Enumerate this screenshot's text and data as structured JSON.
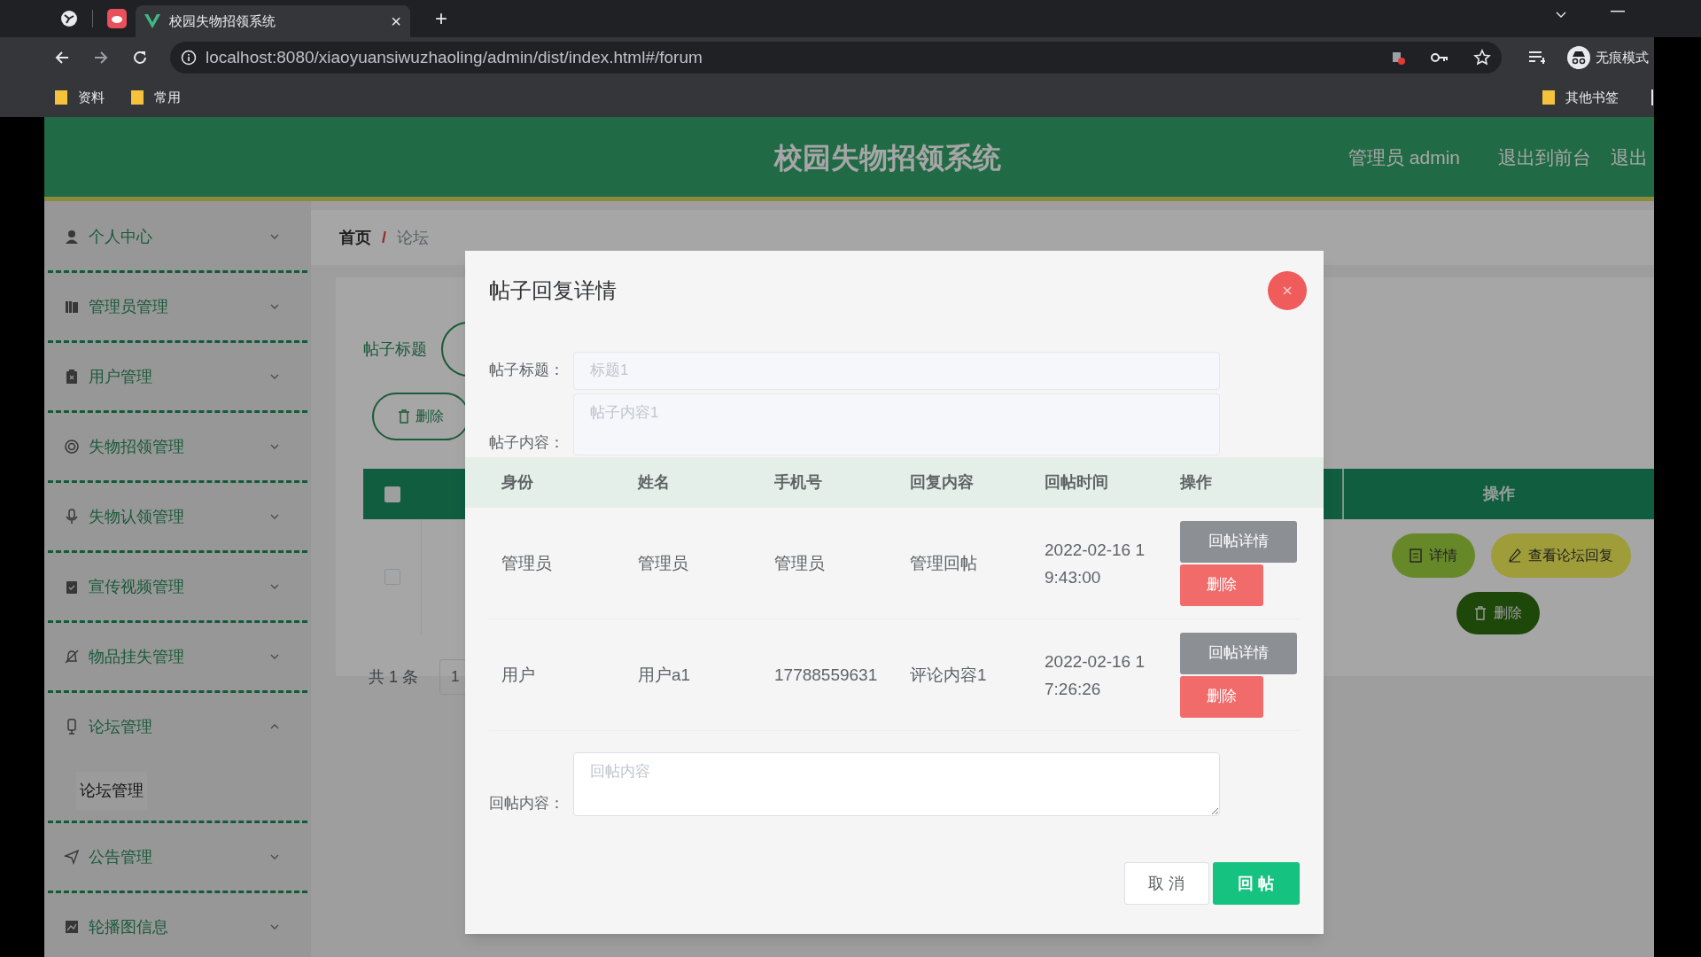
{
  "browser": {
    "tab_title": "校园失物招领系统",
    "close": "×",
    "new_tab": "+",
    "url": "localhost:8080/xiaoyuansiwuzhaoling/admin/dist/index.html#/forum",
    "profile": "无痕模式",
    "bookmarks": [
      "资料",
      "常用"
    ],
    "other_bookmarks": "其他书签"
  },
  "header": {
    "title": "校园失物招领系统",
    "user": "管理员 admin",
    "links": [
      "退出到前台",
      "退出"
    ]
  },
  "sidebar": {
    "items": [
      {
        "label": "个人中心",
        "expanded": false
      },
      {
        "label": "管理员管理",
        "expanded": false
      },
      {
        "label": "用户管理",
        "expanded": false
      },
      {
        "label": "失物招领管理",
        "expanded": false
      },
      {
        "label": "失物认领管理",
        "expanded": false
      },
      {
        "label": "宣传视频管理",
        "expanded": false
      },
      {
        "label": "物品挂失管理",
        "expanded": false
      },
      {
        "label": "论坛管理",
        "expanded": true,
        "children": [
          {
            "label": "论坛管理"
          }
        ]
      },
      {
        "label": "公告管理",
        "expanded": false
      },
      {
        "label": "轮播图信息",
        "expanded": false
      }
    ]
  },
  "breadcrumb": [
    "首页",
    "/",
    "论坛"
  ],
  "search": {
    "label": "帖子标题"
  },
  "delete_button": "删除",
  "table": {
    "select_all": {
      "checked": false
    },
    "column_last": "操作",
    "row": {
      "checked": false
    },
    "row_actions": [
      "详情",
      "查看论坛回复",
      "删除"
    ]
  },
  "pagination": {
    "total": "共 1 条",
    "page": "1"
  },
  "modal": {
    "title": "帖子回复详情",
    "fields": [
      {
        "label": "帖子标题：",
        "value": "标题1"
      },
      {
        "label": "帖子内容：",
        "value": "帖子内容1"
      }
    ],
    "columns": [
      "身份",
      "姓名",
      "手机号",
      "回复内容",
      "回帖时间",
      "操作"
    ],
    "rows": [
      {
        "cells": [
          "管理员",
          "管理员",
          "管理员",
          "管理回帖",
          "2022-02-16 19:43:00"
        ],
        "actions": [
          "回帖详情",
          "删除"
        ]
      },
      {
        "cells": [
          "用户",
          "用户a1",
          "17788559631",
          "评论内容1",
          "2022-02-16 17:26:26"
        ],
        "actions": [
          "回帖详情",
          "删除"
        ]
      }
    ],
    "reply": {
      "label": "回帖内容：",
      "placeholder": "回帖内容"
    },
    "buttons": [
      "取 消",
      "回 帖"
    ]
  }
}
